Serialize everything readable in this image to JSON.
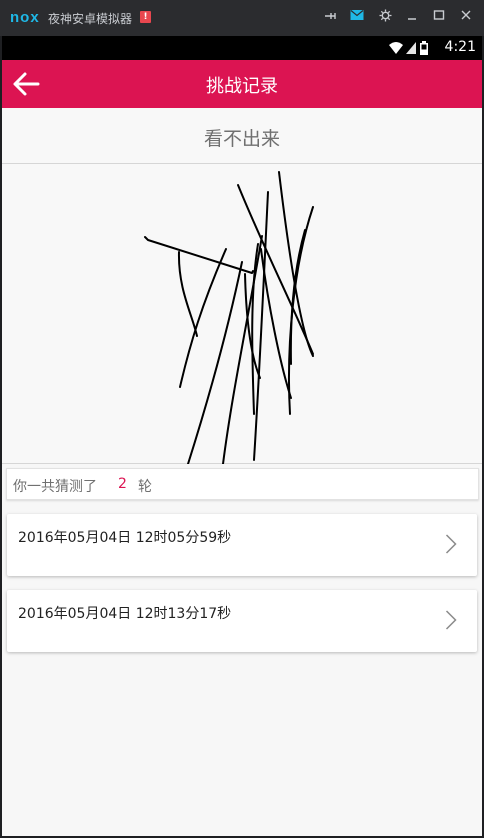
{
  "emulator": {
    "logo": "nox",
    "title": "夜神安卓模拟器",
    "warning_badge": "!",
    "controls": [
      "pin-icon",
      "mail-icon",
      "gear-icon",
      "minimize-icon",
      "maximize-icon",
      "close-icon"
    ]
  },
  "statusbar": {
    "time": "4:21",
    "icons": [
      "wifi-icon",
      "signal-icon",
      "battery-icon"
    ]
  },
  "appbar": {
    "title": "挑战记录",
    "back_icon": "arrow-left-icon"
  },
  "answer": {
    "text": "看不出来"
  },
  "summary": {
    "prefix": "你一共猜测了",
    "count": "2",
    "suffix": "轮"
  },
  "records": [
    {
      "label": "2016年05月04日 12时05分59秒"
    },
    {
      "label": "2016年05月04日 12时13分17秒"
    }
  ],
  "colors": {
    "accent": "#dc1452",
    "background": "#f7f7f7",
    "text_secondary": "#707070"
  }
}
